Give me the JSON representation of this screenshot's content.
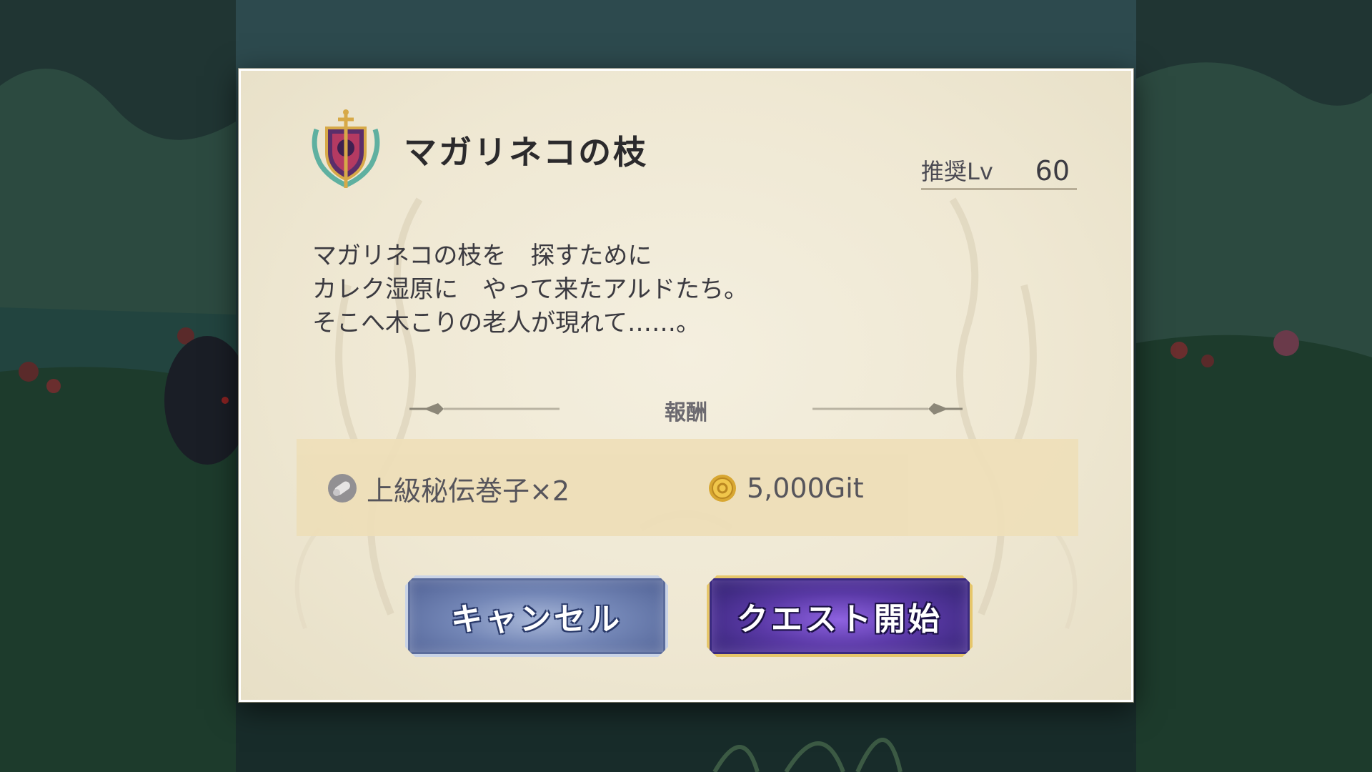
{
  "quest": {
    "title": "マガリネコの枝",
    "recommended_level_label": "推奨Lv",
    "recommended_level_value": "60",
    "description": [
      "マガリネコの枝を　探すために",
      "カレク湿原に　やって来たアルドたち。",
      "そこへ木こりの老人が現れて……。"
    ],
    "emblem_icon": "shield-crest-icon"
  },
  "rewards": {
    "heading": "報酬",
    "items": [
      {
        "icon": "scroll-icon",
        "label": "上級秘伝巻子×2"
      },
      {
        "icon": "coin-icon",
        "label": "5,000Git"
      }
    ]
  },
  "buttons": {
    "cancel_label": "キャンセル",
    "start_label": "クエスト開始"
  },
  "colors": {
    "dialog_bg": "#efe8d3",
    "reward_box": "#eedfb9",
    "cancel_button": "#7386b6",
    "start_button": "#5a39a6",
    "start_border": "#e6c66a"
  }
}
